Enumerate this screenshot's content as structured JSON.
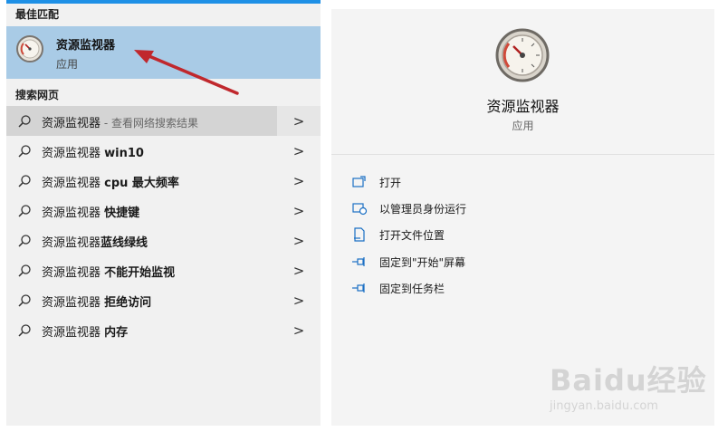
{
  "left_panel": {
    "best_match_title": "最佳匹配",
    "best_match": {
      "name": "资源监视器",
      "type": "应用",
      "icon": "gauge-icon"
    },
    "web_title": "搜索网页",
    "results": [
      {
        "prefix": "资源监视器",
        "bold": "",
        "hint": " - 查看网络搜索结果",
        "selected": true
      },
      {
        "prefix": "资源监视器 ",
        "bold": "win10",
        "hint": "",
        "selected": false
      },
      {
        "prefix": "资源监视器 ",
        "bold": "cpu 最大频率",
        "hint": "",
        "selected": false
      },
      {
        "prefix": "资源监视器 ",
        "bold": "快捷键",
        "hint": "",
        "selected": false
      },
      {
        "prefix": "资源监视器",
        "bold": "蓝线绿线",
        "hint": "",
        "selected": false
      },
      {
        "prefix": "资源监视器 ",
        "bold": "不能开始监视",
        "hint": "",
        "selected": false
      },
      {
        "prefix": "资源监视器 ",
        "bold": "拒绝访问",
        "hint": "",
        "selected": false
      },
      {
        "prefix": "资源监视器 ",
        "bold": "内存",
        "hint": "",
        "selected": false
      }
    ],
    "chevron": ">"
  },
  "right_panel": {
    "title": "资源监视器",
    "subtitle": "应用",
    "actions": [
      {
        "label": "打开",
        "icon": "open-icon"
      },
      {
        "label": "以管理员身份运行",
        "icon": "run-as-admin-icon"
      },
      {
        "label": "打开文件位置",
        "icon": "file-location-icon"
      },
      {
        "label": "固定到\"开始\"屏幕",
        "icon": "pin-icon"
      },
      {
        "label": "固定到任务栏",
        "icon": "pin-icon"
      }
    ]
  },
  "watermark": {
    "main": "Baidu经验",
    "sub": "jingyan.baidu.com"
  },
  "colors": {
    "accent": "#1e90e6",
    "selected_bg": "#a9cbe6",
    "arrow": "#c0282d"
  }
}
